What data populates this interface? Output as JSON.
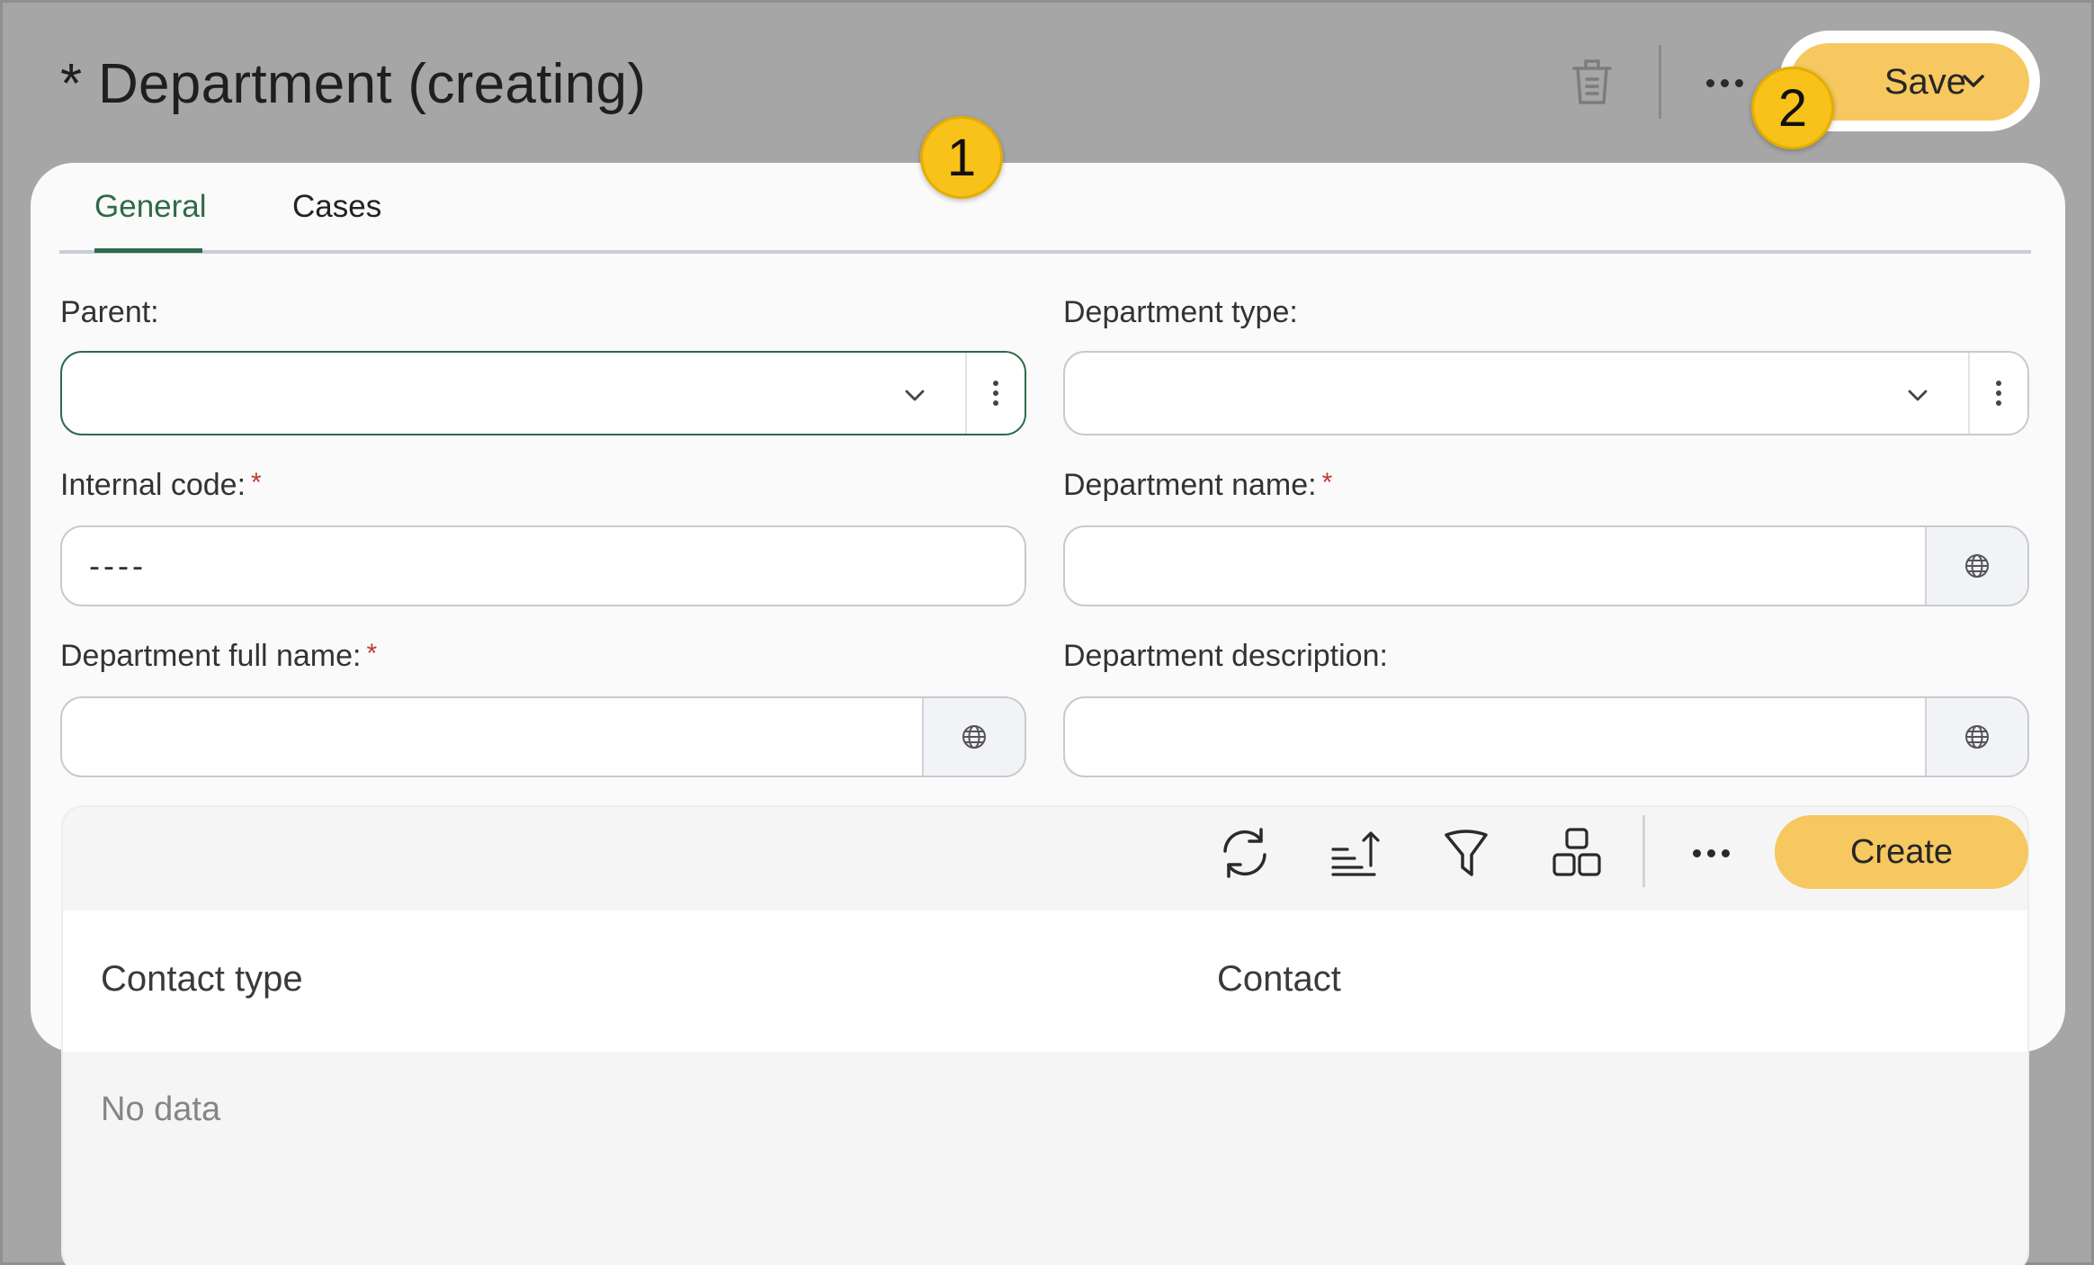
{
  "header": {
    "title": "* Department (creating)",
    "save_label": "Save",
    "icons": [
      "trash-icon",
      "more-icon",
      "chevron-down-icon"
    ]
  },
  "badges": {
    "first": "1",
    "second": "2"
  },
  "tabs": [
    {
      "label": "General",
      "active": true
    },
    {
      "label": "Cases",
      "active": false
    }
  ],
  "form": {
    "parent": {
      "label": "Parent:",
      "value": ""
    },
    "department_type": {
      "label": "Department type:",
      "value": ""
    },
    "internal_code": {
      "label": "Internal code:",
      "required_mark": "*",
      "value": "----"
    },
    "department_name": {
      "label": "Department name:",
      "required_mark": "*",
      "value": ""
    },
    "department_full_name": {
      "label": "Department full name:",
      "required_mark": "*",
      "value": ""
    },
    "department_description": {
      "label": "Department description:",
      "value": ""
    }
  },
  "grid": {
    "toolbar_icons": [
      "refresh-icon",
      "sort-icon",
      "filter-icon",
      "layout-icon",
      "more-icon"
    ],
    "create_label": "Create",
    "columns": [
      "Contact type",
      "Contact"
    ],
    "empty_text": "No data"
  },
  "colors": {
    "accent_green": "#2f6a4a",
    "button_yellow": "#f6c85f",
    "badge_yellow": "#f8c21a",
    "overlay_gray": "#a6a6a6",
    "required_red": "#c0392b"
  }
}
